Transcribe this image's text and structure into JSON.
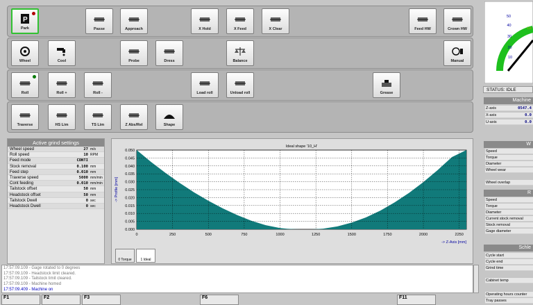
{
  "rows": [
    [
      {
        "label": "Park",
        "icon": "park-icon",
        "x": 5,
        "sel": true,
        "dot": "#b00000"
      },
      {
        "label": "Passe",
        "icon": "passe-icon",
        "x": 112
      },
      {
        "label": "Approach",
        "icon": "approach-icon",
        "x": 162
      },
      {
        "label": "X Hold",
        "icon": "x-hold-icon",
        "x": 264
      },
      {
        "label": "X Feed",
        "icon": "x-feed-icon",
        "x": 315
      },
      {
        "label": "X Clear",
        "icon": "x-clear-icon",
        "x": 366
      },
      {
        "label": "Feed HW",
        "icon": "feed-hw-icon",
        "x": 578
      },
      {
        "label": "Crown HW",
        "icon": "crown-hw-icon",
        "x": 628
      }
    ],
    [
      {
        "label": "Wheel",
        "icon": "wheel-icon",
        "x": 5
      },
      {
        "label": "Cool",
        "icon": "coolant-icon",
        "x": 58
      },
      {
        "label": "Probe",
        "icon": "probe-icon",
        "x": 162
      },
      {
        "label": "Dress",
        "icon": "dress-icon",
        "x": 213
      },
      {
        "label": "Balance",
        "icon": "balance-icon",
        "x": 315
      },
      {
        "label": "Manual",
        "icon": "manual-icon",
        "x": 628
      }
    ],
    [
      {
        "label": "Roll",
        "icon": "roll-icon",
        "x": 5,
        "dot": "#0a7a0a"
      },
      {
        "label": "Roll +",
        "icon": "roll-plus-icon",
        "x": 58
      },
      {
        "label": "Roll -",
        "icon": "roll-minus-icon",
        "x": 110
      },
      {
        "label": "Load roll",
        "icon": "load-roll-icon",
        "x": 264
      },
      {
        "label": "Unload roll",
        "icon": "unload-roll-icon",
        "x": 315
      },
      {
        "label": "Grease",
        "icon": "grease-icon",
        "x": 526
      }
    ],
    [
      {
        "label": "Traverse",
        "icon": "traverse-icon",
        "x": 5
      },
      {
        "label": "HS Lim",
        "icon": "hs-lim-icon",
        "x": 58
      },
      {
        "label": "TS Lim",
        "icon": "ts-lim-icon",
        "x": 110
      },
      {
        "label": "Z Abs/Rel",
        "icon": "z-abs-rel-icon",
        "x": 162
      },
      {
        "label": "Shape",
        "icon": "shape-icon",
        "x": 213
      }
    ]
  ],
  "grind": {
    "title": "Active grind settings",
    "items": [
      {
        "k": "Wheel speed",
        "v": "27",
        "u": "m/s"
      },
      {
        "k": "Roll speed",
        "v": "10",
        "u": "RPM"
      },
      {
        "k": "Feed mode",
        "v": "CONTI",
        "u": ""
      },
      {
        "k": "Stock removal",
        "v": "0.100",
        "u": "mm"
      },
      {
        "k": "Feed step",
        "v": "0.010",
        "u": "mm"
      },
      {
        "k": "Traverse speed",
        "v": "5000",
        "u": "mm/min"
      },
      {
        "k": "Cont feeding",
        "v": "0.010",
        "u": "mm/min"
      },
      {
        "k": "Tailstock offset",
        "v": "50",
        "u": "mm"
      },
      {
        "k": "Headstock offset",
        "v": "50",
        "u": "mm"
      },
      {
        "k": "Tailstock Dwell",
        "v": "0",
        "u": "sec"
      },
      {
        "k": "Headstock Dwell",
        "v": "0",
        "u": "sec"
      }
    ]
  },
  "chart_data": {
    "type": "area",
    "title": "Ideal shape '10_H'",
    "ylabel": "-> Profile [mm]",
    "xlabel": "-> Z-Axis [mm]",
    "xlim": [
      0,
      2300
    ],
    "ylim": [
      0,
      0.05
    ],
    "xticks": [
      "0",
      "250",
      "500",
      "750",
      "1000",
      "1250",
      "1500",
      "1750",
      "2000",
      "2250"
    ],
    "yticks": [
      "0.000",
      "0.005",
      "0.010",
      "0.015",
      "0.020",
      "0.025",
      "0.030",
      "0.035",
      "0.040",
      "0.045",
      "0.050"
    ],
    "x": [
      0,
      100,
      200,
      300,
      400,
      500,
      600,
      700,
      800,
      900,
      1000,
      1050,
      1100,
      1150,
      1200,
      1250,
      1300,
      1400,
      1500,
      1600,
      1700,
      1800,
      1900,
      2000,
      2100,
      2200,
      2300
    ],
    "y": [
      0.05,
      0.0425,
      0.0356,
      0.0292,
      0.0233,
      0.018,
      0.0132,
      0.009,
      0.0054,
      0.0026,
      0.0008,
      0.0003,
      0.0001,
      0,
      0,
      0.0001,
      0.0004,
      0.0018,
      0.0042,
      0.0075,
      0.0118,
      0.017,
      0.023,
      0.0298,
      0.0374,
      0.0456,
      0.05
    ],
    "color": "#117a7a"
  },
  "chart_tabs": [
    {
      "label": "0 Torque"
    },
    {
      "label": "1 Ideal"
    }
  ],
  "log": [
    "17:57:09.109 - Gage rotated to 0 degrees",
    "17:57:09.109 - Headstock limit cleared.",
    "17:57:09.109 - Tailstock limit cleared.",
    "17:57:09.109 - Machine homed",
    "17:57:09.409 - Machine on"
  ],
  "fkeys": [
    {
      "label": "F1",
      "x": 2,
      "w": 56
    },
    {
      "label": "F2",
      "x": 60,
      "w": 56
    },
    {
      "label": "F3",
      "x": 118,
      "w": 56
    },
    {
      "label": "F6",
      "x": 288,
      "w": 56
    },
    {
      "label": "F11",
      "x": 572,
      "w": 56
    }
  ],
  "gauge": {
    "ticks": [
      "50",
      "40",
      "30",
      "20",
      "10"
    ]
  },
  "status": "STATUS: IDLE",
  "machine": {
    "title": "Machine",
    "axes": [
      {
        "k": "Z-axis",
        "v": "0547.4"
      },
      {
        "k": "X-axis",
        "v": "0.0"
      },
      {
        "k": "U-axis",
        "v": "0.0"
      }
    ]
  },
  "wheel": {
    "title": "W",
    "items": [
      "Speed",
      "Torque",
      "Diameter",
      "Wheel wear"
    ],
    "extra": "Wheel overlap"
  },
  "roll": {
    "title": "R",
    "items": [
      "Speed",
      "Torque",
      "Diameter",
      "Current stock removal",
      "Stock removal",
      "Gage diameter"
    ]
  },
  "schle": {
    "title": "Schle",
    "items": [
      "Cycle start",
      "Cycle end",
      "Grind time"
    ],
    "extra": "Cabinet temp",
    "extra2": [
      "Operating hours counter",
      "Tray passes"
    ]
  }
}
